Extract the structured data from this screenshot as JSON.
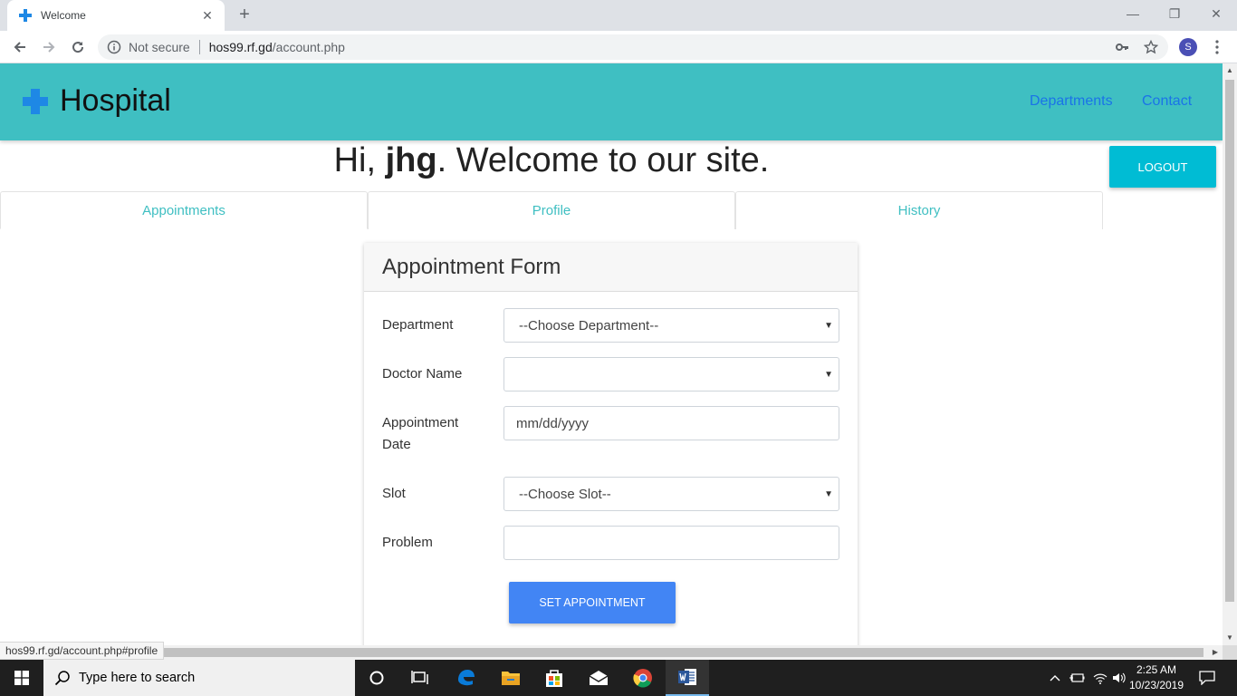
{
  "browser": {
    "tab_title": "Welcome",
    "security_label": "Not secure",
    "url_host": "hos99.rf.gd",
    "url_path": "/account.php",
    "profile_initial": "S",
    "status_url": "hos99.rf.gd/account.php#profile"
  },
  "site": {
    "brand": "Hospital",
    "nav": [
      "Departments",
      "Contact"
    ],
    "greeting_prefix": "Hi, ",
    "username": "jhg",
    "greeting_suffix": ". Welcome to our site.",
    "logout_label": "LOGOUT",
    "tabs": [
      "Appointments",
      "Profile",
      "History"
    ],
    "active_tab": "Appointments",
    "accent_color": "#3fbfc2"
  },
  "form": {
    "title": "Appointment Form",
    "fields": [
      {
        "label": "Department",
        "value": "--Choose Department--",
        "type": "select"
      },
      {
        "label": "Doctor Name",
        "value": "",
        "type": "select"
      },
      {
        "label": "Appointment Date",
        "value": "mm/dd/yyyy",
        "type": "date"
      },
      {
        "label": "Slot",
        "value": "--Choose Slot--",
        "type": "select"
      },
      {
        "label": "Problem",
        "value": "",
        "type": "text"
      }
    ],
    "submit_label": "SET APPOINTMENT"
  },
  "taskbar": {
    "search_placeholder": "Type here to search",
    "time": "2:25 AM",
    "date": "10/23/2019",
    "pinned": [
      "task-view-icon",
      "edge-icon",
      "file-explorer-icon",
      "store-icon",
      "mail-icon",
      "chrome-icon",
      "word-icon"
    ]
  }
}
